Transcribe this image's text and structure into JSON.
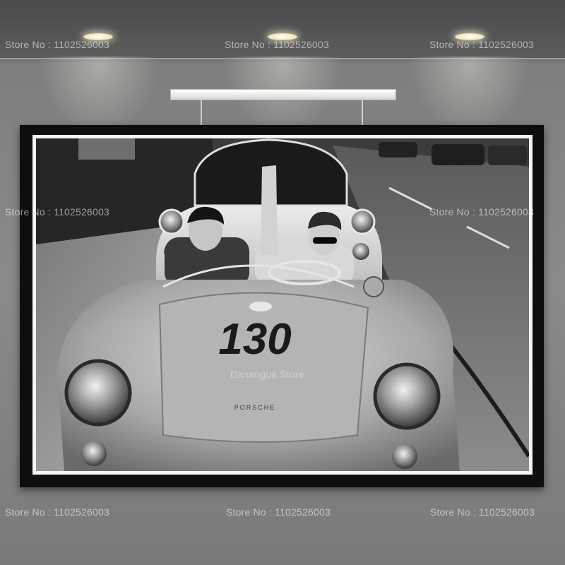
{
  "watermarks": {
    "store_label": "Store No : 1102526003",
    "brand_label": "Danangua Store"
  },
  "photo": {
    "race_number": "130",
    "hood_badge": "PORSCHE"
  },
  "colors": {
    "wall": "#8a8a8a",
    "frame": "#0e0e0e",
    "mat": "#f4f4f4"
  }
}
